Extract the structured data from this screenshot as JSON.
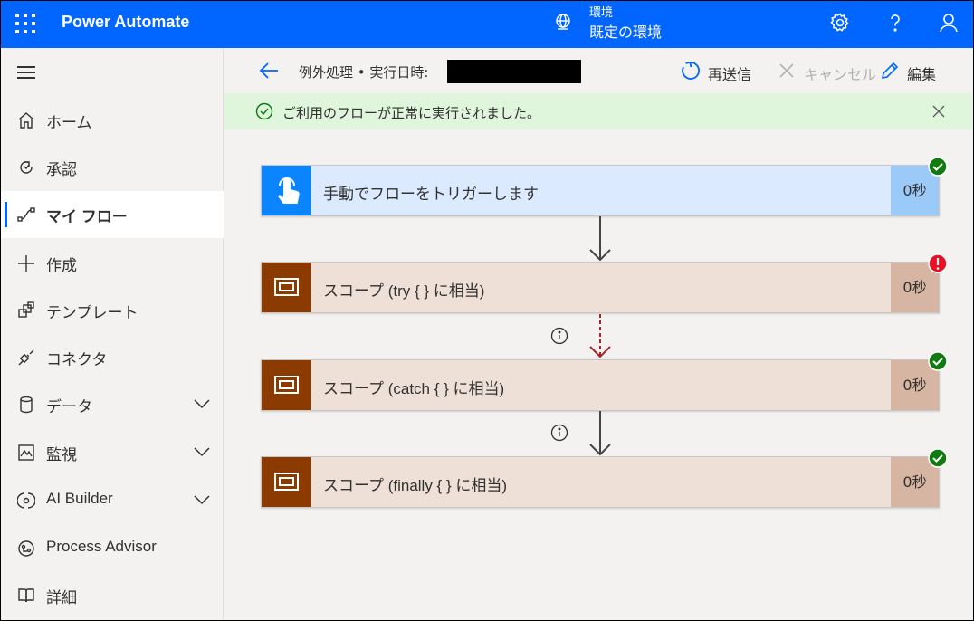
{
  "header": {
    "app_title": "Power Automate",
    "env_label": "環境",
    "env_value": "既定の環境",
    "color": "#0066ff"
  },
  "sidebar": {
    "items": [
      {
        "label": "ホーム",
        "icon": "home-icon"
      },
      {
        "label": "承認",
        "icon": "approval-icon"
      },
      {
        "label": "マイ フロー",
        "icon": "flow-icon",
        "selected": true
      },
      {
        "label": "作成",
        "icon": "plus-icon"
      },
      {
        "label": "テンプレート",
        "icon": "template-icon"
      },
      {
        "label": "コネクタ",
        "icon": "connector-icon"
      },
      {
        "label": "データ",
        "icon": "database-icon",
        "expandable": true
      },
      {
        "label": "監視",
        "icon": "monitor-icon",
        "expandable": true
      },
      {
        "label": "AI Builder",
        "icon": "ai-builder-icon",
        "expandable": true
      },
      {
        "label": "Process Advisor",
        "icon": "process-advisor-icon"
      },
      {
        "label": "詳細",
        "icon": "book-icon"
      }
    ]
  },
  "cmdbar": {
    "breadcrumb": "例外処理 • 実行日時:",
    "resubmit": "再送信",
    "cancel": "キャンセル",
    "edit": "編集"
  },
  "banner": {
    "message": "ご利用のフローが正常に実行されました。"
  },
  "flow": {
    "steps": [
      {
        "title": "手動でフローをトリガーします",
        "duration": "0秒",
        "status": "success",
        "kind": "trigger"
      },
      {
        "title": "スコープ (try { } に相当)",
        "duration": "0秒",
        "status": "failed",
        "kind": "scope"
      },
      {
        "title": "スコープ (catch { } に相当)",
        "duration": "0秒",
        "status": "success",
        "kind": "scope"
      },
      {
        "title": "スコープ (finally { } に相当)",
        "duration": "0秒",
        "status": "success",
        "kind": "scope"
      }
    ]
  }
}
